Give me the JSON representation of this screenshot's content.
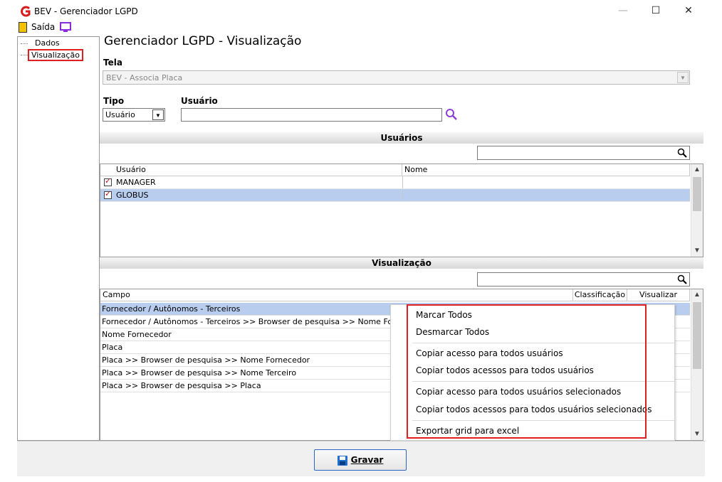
{
  "window": {
    "title": "BEV - Gerenciador LGPD",
    "minimize": "—",
    "maximize": "☐",
    "close": "✕"
  },
  "toolbar": {
    "exit_label": "Saída"
  },
  "tree": {
    "items": [
      {
        "label": "Dados"
      },
      {
        "label": "Visualização",
        "highlighted": true
      }
    ]
  },
  "page": {
    "title": "Gerenciador LGPD - Visualização"
  },
  "form": {
    "tela_label": "Tela",
    "tela_value": "BEV - Associa Placa",
    "tipo_label": "Tipo",
    "tipo_value": "Usuário",
    "usuario_label": "Usuário",
    "usuario_value": ""
  },
  "users_section": {
    "title": "Usuários",
    "search_value": "",
    "columns": [
      "Usuário",
      "Nome"
    ],
    "rows": [
      {
        "usuario": "MANAGER",
        "nome": "",
        "checked": true,
        "selected": false
      },
      {
        "usuario": "GLOBUS",
        "nome": "",
        "checked": true,
        "selected": true
      }
    ]
  },
  "vis_section": {
    "title": "Visualização",
    "search_value": "",
    "columns": [
      "Campo",
      "Classificação",
      "Visualizar"
    ],
    "rows": [
      "Fornecedor / Autônomos - Terceiros",
      "Fornecedor / Autônomos - Terceiros >> Browser de pesquisa >> Nome Fornecedor",
      "Nome Fornecedor",
      "Placa",
      "Placa >> Browser de pesquisa >> Nome Fornecedor",
      "Placa >> Browser de pesquisa >> Nome Terceiro",
      "Placa >> Browser de pesquisa >> Placa"
    ]
  },
  "context_menu": {
    "items": [
      "Marcar Todos",
      "Desmarcar Todos",
      "Copiar acesso para todos usuários",
      "Copiar todos acessos para todos usuários",
      "Copiar acesso para todos usuários selecionados",
      "Copiar todos acessos para todos usuários selecionados",
      "Exportar grid para excel"
    ]
  },
  "footer": {
    "save_label": "Gravar"
  },
  "colors": {
    "selection": "#b9cdef",
    "highlight_border": "#e02020",
    "accent": "#2b66c6",
    "search_icon": "#8a3fd0"
  }
}
